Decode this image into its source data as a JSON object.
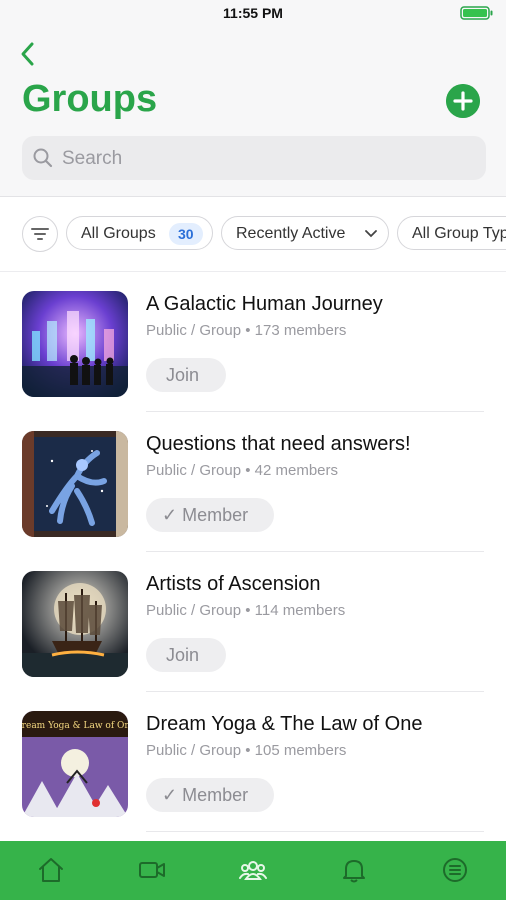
{
  "status_bar": {
    "time": "11:55 PM"
  },
  "header": {
    "title": "Groups"
  },
  "search": {
    "placeholder": "Search"
  },
  "filters": {
    "all_groups_label": "All Groups",
    "all_groups_count": "30",
    "recently_active_label": "Recently Active",
    "group_type_label": "All Group Types"
  },
  "groups": [
    {
      "name": "A Galactic Human Journey",
      "type": "Public / Group",
      "members": "173 members",
      "action": "Join"
    },
    {
      "name": "Questions that need answers!",
      "type": "Public / Group",
      "members": "42 members",
      "action": "✓ Member"
    },
    {
      "name": "Artists of Ascension",
      "type": "Public / Group",
      "members": "114 members",
      "action": "Join"
    },
    {
      "name": "Dream Yoga & The Law of One",
      "type": "Public / Group",
      "members": "105 members",
      "action": "✓ Member",
      "thumb_text": "Dream Yoga & Law of One"
    }
  ],
  "tabbar": {
    "icons": [
      "home-icon",
      "video-icon",
      "groups-icon",
      "bell-icon",
      "menu-icon"
    ]
  },
  "colors": {
    "accent": "#2aa54a",
    "tabbar": "#36b34a",
    "badge_text": "#2b6fd8"
  }
}
